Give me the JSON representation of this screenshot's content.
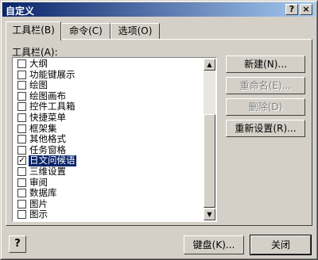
{
  "window": {
    "title": "自定义",
    "help_glyph": "?",
    "close_glyph": "×"
  },
  "tabs": [
    {
      "label": "工具栏(B)"
    },
    {
      "label": "命令(C)"
    },
    {
      "label": "选项(O)"
    }
  ],
  "toolbars": {
    "label": "工具栏(A):",
    "items": [
      {
        "label": "大纲",
        "checked": false
      },
      {
        "label": "功能键展示",
        "checked": false
      },
      {
        "label": "绘图",
        "checked": false
      },
      {
        "label": "绘图画布",
        "checked": false
      },
      {
        "label": "控件工具箱",
        "checked": false
      },
      {
        "label": "快捷菜单",
        "checked": false
      },
      {
        "label": "框架集",
        "checked": false
      },
      {
        "label": "其他格式",
        "checked": false
      },
      {
        "label": "任务窗格",
        "checked": false
      },
      {
        "label": "日文问候语",
        "checked": true,
        "selected": true
      },
      {
        "label": "三维设置",
        "checked": false
      },
      {
        "label": "审阅",
        "checked": false
      },
      {
        "label": "数据库",
        "checked": false
      },
      {
        "label": "图片",
        "checked": false
      },
      {
        "label": "图示",
        "checked": false
      }
    ]
  },
  "buttons": {
    "new": "新建(N)...",
    "rename": "重命名(E)...",
    "delete": "删除(D)",
    "reset": "重新设置(R)...",
    "keyboard": "键盘(K)...",
    "close": "关闭",
    "help_glyph": "?"
  },
  "scrollbar": {
    "up_glyph": "▲",
    "down_glyph": "▼"
  }
}
